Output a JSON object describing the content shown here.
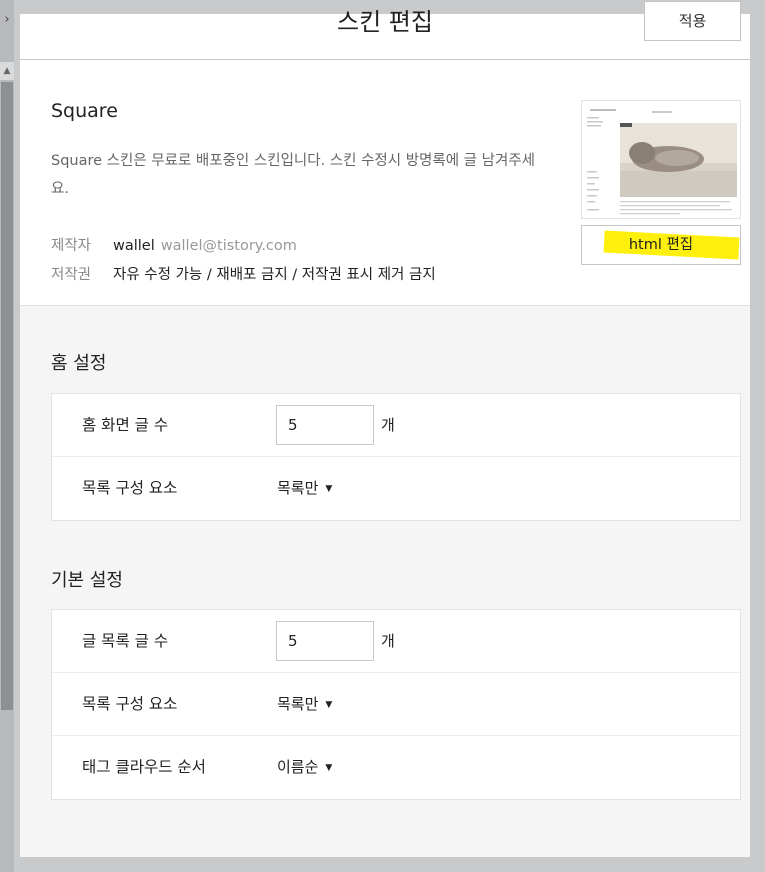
{
  "panel": {
    "title": "스킨 편집",
    "apply_label": "적용"
  },
  "skin": {
    "name": "Square",
    "description": "Square 스킨은 무료로 배포중인 스킨입니다. 스킨 수정시 방명록에 글 남겨주세요.",
    "maker_label": "제작자",
    "maker_name": "wallel",
    "maker_email": "wallel@tistory.com",
    "copyright_label": "저작권",
    "copyright_value": "자유 수정 가능 / 재배포 금지 / 저작권 표시 제거 금지",
    "html_edit_label": "html 편집"
  },
  "home_settings": {
    "title": "홈 설정",
    "rows": [
      {
        "label": "홈 화면 글 수",
        "value": "5",
        "unit": "개"
      },
      {
        "label": "목록 구성 요소",
        "selected": "목록만"
      }
    ]
  },
  "basic_settings": {
    "title": "기본 설정",
    "rows": [
      {
        "label": "글 목록 글 수",
        "value": "5",
        "unit": "개"
      },
      {
        "label": "목록 구성 요소",
        "selected": "목록만"
      },
      {
        "label": "태그 클라우드 순서",
        "selected": "이름순"
      }
    ]
  },
  "colors": {
    "backdrop": "#c9cacc",
    "panel_bg": "#f5f5f6",
    "highlight": "#ffee00"
  }
}
